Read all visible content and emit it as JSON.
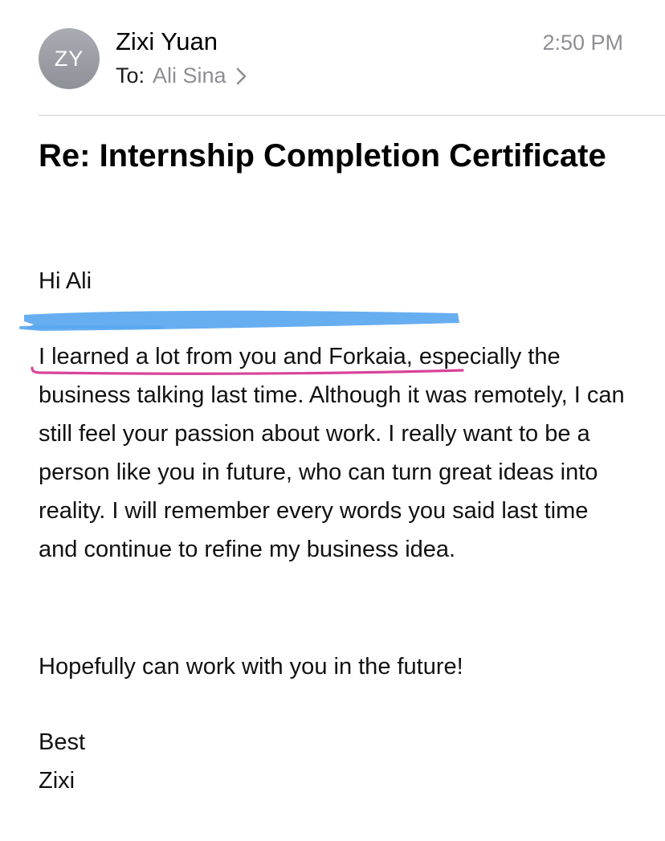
{
  "header": {
    "avatar_initials": "ZY",
    "sender_name": "Zixi Yuan",
    "to_label": "To:",
    "recipient_name": "Ali Sina",
    "timestamp": "2:50 PM"
  },
  "email": {
    "subject": "Re: Internship Completion Certificate",
    "greeting": "Hi Ali",
    "paragraph": "I learned a lot from you and Forkaia, especially the business talking last time. Although it was remotely, I can still feel your passion about work. I really want to be a person like you in future, who can turn great ideas into reality. I will remember every words you said last time and continue to refine my business idea.",
    "closing_line": "Hopefully can work with you in the future!",
    "signoff": "Best",
    "signature": "Zixi"
  },
  "annotations": {
    "redaction_color": "#5aa7f0",
    "underline_color": "#d9439a"
  },
  "colors": {
    "avatar_bg": "#9a9ea4",
    "secondary_text": "#8e8e93",
    "divider": "#d1d1d6"
  }
}
